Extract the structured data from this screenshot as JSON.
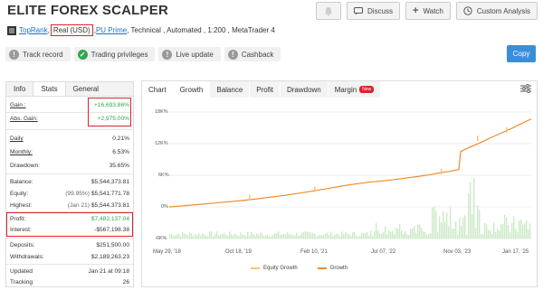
{
  "title": "ELITE FOREX SCALPER",
  "top_buttons": {
    "discuss": "Discuss",
    "watch": "Watch",
    "custom_analysis": "Custom Analysis"
  },
  "subline": {
    "user": "TopRank",
    "account": "Real (USD)",
    "broker": "PU Prime",
    "rest": ", Technical , Automated , 1:200 , MetaTrader 4"
  },
  "badges": [
    "Track record",
    "Trading privileges",
    "Live update",
    "Cashback"
  ],
  "copy_label": "Copy",
  "left_tabs": [
    "Info",
    "Stats",
    "General"
  ],
  "stats": {
    "gain": {
      "label": "Gain :",
      "value": "+16,693.86%"
    },
    "abs_gain": {
      "label": "Abs. Gain:",
      "value": "+2,975.00%"
    },
    "daily": {
      "label": "Daily",
      "value": "0.21%"
    },
    "monthly": {
      "label": "Monthly:",
      "value": "6.53%"
    },
    "drawdown": {
      "label": "Drawdown:",
      "value": "35.65%"
    },
    "balance": {
      "label": "Balance:",
      "value": "$5,544,373.81"
    },
    "equity": {
      "label": "Equity:",
      "sub": "(99.95%)",
      "value": "$5,541,771.78"
    },
    "highest": {
      "label": "Highest:",
      "sub": "(Jan 21)",
      "value": "$5,544,373.81"
    },
    "profit": {
      "label": "Profit:",
      "value": "$7,482,137.04"
    },
    "interest": {
      "label": "Interest:",
      "value": "-$567,198.38"
    },
    "deposits": {
      "label": "Deposits:",
      "value": "$251,500.00"
    },
    "withdrawals": {
      "label": "Withdrawals:",
      "value": "$2,189,263.23"
    },
    "updated": {
      "label": "Updated",
      "value": "Jan 21 at 09:18"
    },
    "tracking": {
      "label": "Tracking",
      "value": "26"
    }
  },
  "chart_tabs": [
    "Chart",
    "Growth",
    "Balance",
    "Profit",
    "Drawdown",
    "Margin"
  ],
  "new_badge": "New",
  "chart_data": {
    "type": "line",
    "x_tick_labels": [
      "May 29, '18",
      "Oct 18, '19",
      "Feb 10, '21",
      "Jul 07, '22",
      "Nov 03, '23",
      "Jan 17, '25"
    ],
    "y_tick_labels": [
      "18K%",
      "12K%",
      "6K%",
      "0%",
      "-6K%"
    ],
    "ylim": [
      -6000,
      18000
    ],
    "series": [
      {
        "name": "Growth",
        "color": "#f08a2c",
        "x": [
          0,
          0.04,
          0.08,
          0.12,
          0.16,
          0.2,
          0.24,
          0.28,
          0.32,
          0.36,
          0.4,
          0.44,
          0.48,
          0.52,
          0.56,
          0.6,
          0.64,
          0.68,
          0.72,
          0.75,
          0.78,
          0.8,
          0.805,
          0.82,
          0.86,
          0.9,
          0.94,
          0.97,
          1.0
        ],
        "y": [
          0,
          200,
          450,
          700,
          950,
          1200,
          1500,
          1850,
          2200,
          2600,
          3050,
          3500,
          4000,
          4400,
          4750,
          5000,
          5350,
          5700,
          6100,
          6500,
          6800,
          7100,
          10500,
          11000,
          12200,
          13500,
          14700,
          15700,
          16694
        ]
      },
      {
        "name": "Equity Growth",
        "color": "#f5c86b",
        "x": [
          0.22,
          0.4,
          0.75,
          0.85,
          0.93
        ],
        "y": [
          1800,
          3300,
          6700,
          13000,
          14600
        ]
      }
    ],
    "volume_bars": true
  },
  "legend": [
    "Equity Growth",
    "Growth"
  ]
}
